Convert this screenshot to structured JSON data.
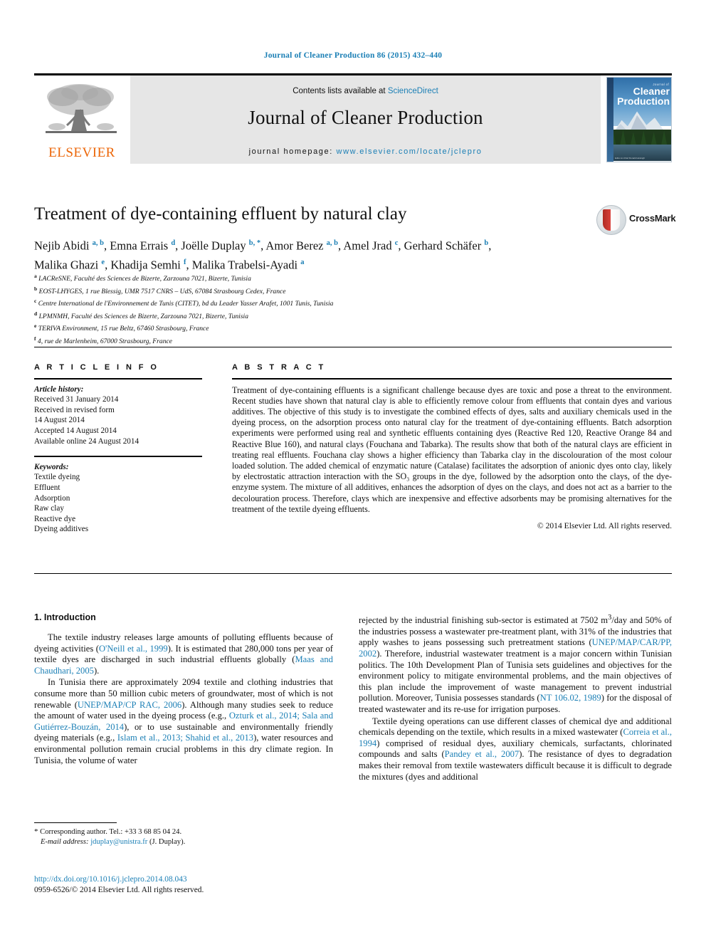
{
  "running_head": "Journal of Cleaner Production 86 (2015) 432–440",
  "masthead": {
    "contents_prefix": "Contents lists available at ",
    "contents_link": "ScienceDirect",
    "journal_title": "Journal of Cleaner Production",
    "homepage_prefix": "journal homepage: ",
    "homepage_url": "www.elsevier.com/locate/jclepro",
    "publisher_wordmark": "ELSEVIER",
    "cover": {
      "kicker": "Journal of",
      "line1": "Cleaner",
      "line2": "Production",
      "footer": "Editor-in-Chief  Donald Huisingh"
    }
  },
  "article": {
    "title": "Treatment of dye-containing effluent by natural clay",
    "authors_html": "Nejib Abidi <sup>a, b</sup>, Emna Errais <sup>d</sup>, Joëlle Duplay <sup>b, *</sup>, Amor Berez <sup>a, b</sup>, Amel Jrad <sup>c</sup>, Gerhard Schäfer <sup>b</sup>, Malika Ghazi <sup>e</sup>, Khadija Semhi <sup>f</sup>, Malika Trabelsi-Ayadi <sup>a</sup>",
    "crossmark_label": "CrossMark",
    "affiliations": [
      {
        "mark": "a",
        "text": "LACReSNE, Faculté des Sciences de Bizerte, Zarzouna 7021, Bizerte, Tunisia"
      },
      {
        "mark": "b",
        "text": "EOST-LHYGES, 1 rue Blessig, UMR 7517 CNRS – UdS, 67084 Strasbourg Cedex, France"
      },
      {
        "mark": "c",
        "text": "Centre International de l'Environnement de Tunis (CITET), bd du Leader Yasser Arafet, 1001 Tunis, Tunisia"
      },
      {
        "mark": "d",
        "text": "LPMNMH, Faculté des Sciences de Bizerte, Zarzouna 7021, Bizerte, Tunisia"
      },
      {
        "mark": "e",
        "text": "TERIVA Environment, 15 rue Beltz, 67460 Strasbourg, France"
      },
      {
        "mark": "f",
        "text": "4, rue de Marlenheim, 67000 Strasbourg, France"
      }
    ]
  },
  "article_info": {
    "heading": "A R T I C L E  I N F O",
    "history_label": "Article history:",
    "history": [
      "Received 31 January 2014",
      "Received in revised form",
      "14 August 2014",
      "Accepted 14 August 2014",
      "Available online 24 August 2014"
    ],
    "keywords_label": "Keywords:",
    "keywords": [
      "Textile dyeing",
      "Effluent",
      "Adsorption",
      "Raw clay",
      "Reactive dye",
      "Dyeing additives"
    ]
  },
  "abstract": {
    "heading": "A B S T R A C T",
    "text": "Treatment of dye-containing effluents is a significant challenge because dyes are toxic and pose a threat to the environment. Recent studies have shown that natural clay is able to efficiently remove colour from effluents that contain dyes and various additives. The objective of this study is to investigate the combined effects of dyes, salts and auxiliary chemicals used in the dyeing process, on the adsorption process onto natural clay for the treatment of dye-containing effluents. Batch adsorption experiments were performed using real and synthetic effluents containing dyes (Reactive Red 120, Reactive Orange 84 and Reactive Blue 160), and natural clays (Fouchana and Tabarka). The results show that both of the natural clays are efficient in treating real effluents. Fouchana clay shows a higher efficiency than Tabarka clay in the discolouration of the most colour loaded solution. The added chemical of enzymatic nature (Catalase) facilitates the adsorption of anionic dyes onto clay, likely by electrostatic attraction interaction with the SO₃ groups in the dye, followed by the adsorption onto the clays, of the dye-enzyme system. The mixture of all additives, enhances the adsorption of dyes on the clays, and does not act as a barrier to the decolouration process. Therefore, clays which are inexpensive and effective adsorbents may be promising alternatives for the treatment of the textile dyeing effluents.",
    "copyright": "© 2014 Elsevier Ltd. All rights reserved."
  },
  "body": {
    "section_heading": "1. Introduction",
    "left_paragraphs_html": [
      "The textile industry releases large amounts of polluting effluents because of dyeing activities (<a class=\"ref\" href=\"#\">O'Neill et al., 1999</a>). It is estimated that 280,000 tons per year of textile dyes are discharged in such industrial effluents globally (<a class=\"ref\" href=\"#\">Maas and Chaudhari, 2005</a>).",
      "In Tunisia there are approximately 2094 textile and clothing industries that consume more than 50 million cubic meters of groundwater, most of which is not renewable (<a class=\"ref\" href=\"#\">UNEP/MAP/CP RAC, 2006</a>). Although many studies seek to reduce the amount of water used in the dyeing process (e.g., <a class=\"ref\" href=\"#\">Ozturk et al., 2014; Sala and Gutiérrez-Bouzán, 2014</a>), or to use sustainable and environmentally friendly dyeing materials (e.g., <a class=\"ref\" href=\"#\">Islam et al., 2013; Shahid et al., 2013</a>), water resources and environmental pollution remain crucial problems in this dry climate region. In Tunisia, the volume of water"
    ],
    "right_paragraphs_html": [
      "rejected by the industrial finishing sub-sector is estimated at 7502 m<sup>3</sup>/day and 50% of the industries possess a wastewater pre-treatment plant, with 31% of the industries that apply washes to jeans possessing such pretreatment stations (<a class=\"ref\" href=\"#\">UNEP/MAP/CAR/PP, 2002</a>). Therefore, industrial wastewater treatment is a major concern within Tunisian politics. The 10th Development Plan of Tunisia sets guidelines and objectives for the environment policy to mitigate environmental problems, and the main objectives of this plan include the improvement of waste management to prevent industrial pollution. Moreover, Tunisia possesses standards (<a class=\"ref\" href=\"#\">NT 106.02, 1989</a>) for the disposal of treated wastewater and its re-use for irrigation purposes.",
      "Textile dyeing operations can use different classes of chemical dye and additional chemicals depending on the textile, which results in a mixed wastewater (<a class=\"ref\" href=\"#\">Correia et al., 1994</a>) comprised of residual dyes, auxiliary chemicals, surfactants, chlorinated compounds and salts (<a class=\"ref\" href=\"#\">Pandey et al., 2007</a>). The resistance of dyes to degradation makes their removal from textile wastewaters difficult because it is difficult to degrade the mixtures (dyes and additional"
    ]
  },
  "footnote": {
    "corresponding_html": "<span class=\"star\">*</span> Corresponding author. Tel.: +33 3 68 85 04 24.",
    "email_label": "E-mail address:",
    "email": "jduplay@unistra.fr",
    "email_suffix": "(J. Duplay)."
  },
  "doi_block": {
    "doi": "http://dx.doi.org/10.1016/j.jclepro.2014.08.043",
    "issn_line": "0959-6526/© 2014 Elsevier Ltd. All rights reserved."
  },
  "colors": {
    "link": "#1b7fb5",
    "elsevier_orange": "#ec6608",
    "masthead_bg": "#e6e6e6"
  }
}
